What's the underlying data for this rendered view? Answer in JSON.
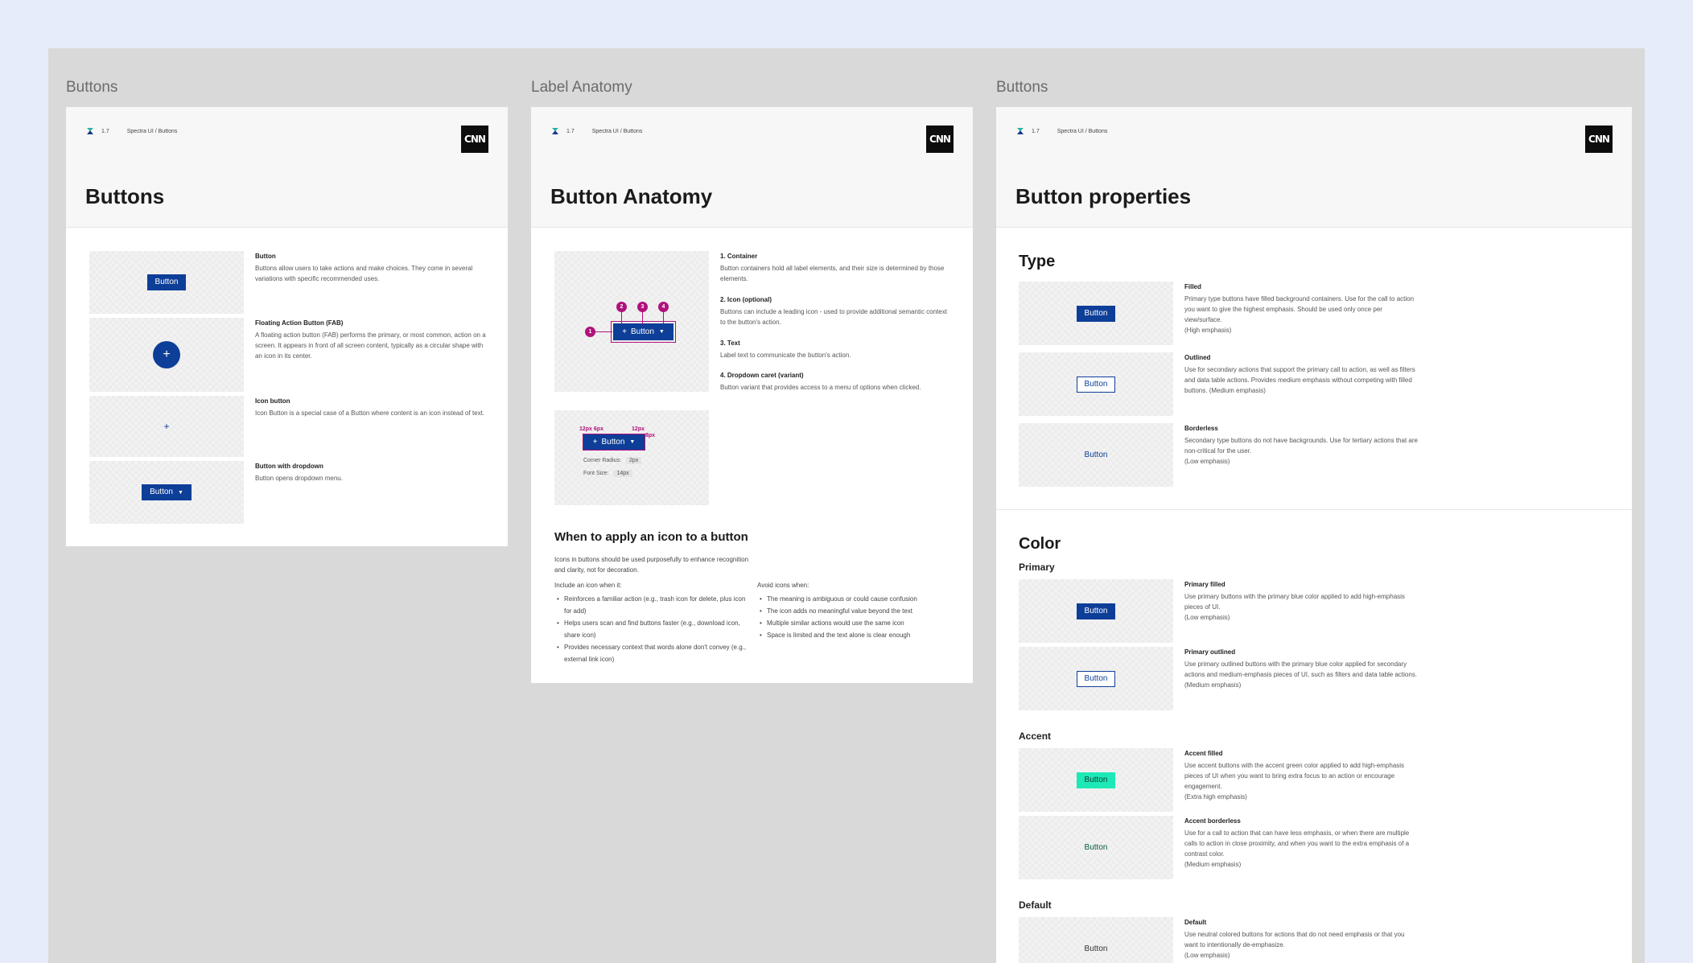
{
  "frames": [
    {
      "frame_label": "Buttons",
      "breadcrumb": {
        "version": "1.7",
        "path": "Spectra UI / Buttons"
      },
      "brand": "CNN",
      "heading": "Buttons",
      "items": [
        {
          "button": "Button",
          "title": "Button",
          "body": "Buttons allow users to take actions and make choices. They come in several variations with specific recommended uses."
        },
        {
          "button": "+",
          "title": "Floating Action Button (FAB)",
          "body": "A floating action button (FAB) performs the primary, or most common, action on a screen. It appears in front of all screen content, typically as a circular shape with an icon in its center."
        },
        {
          "button": "+",
          "title": "Icon button",
          "body": "Icon Button is a special case of a Button where content is an icon instead of text."
        },
        {
          "button": "Button",
          "title": "Button with dropdown",
          "body": "Button opens dropdown menu."
        }
      ]
    },
    {
      "frame_label": "Label Anatomy",
      "breadcrumb": {
        "version": "1.7",
        "path": "Spectra UI / Buttons"
      },
      "brand": "CNN",
      "heading": "Button Anatomy",
      "anatomy_button": "Button",
      "anatomy_pins": [
        "1",
        "2",
        "3",
        "4"
      ],
      "parts": [
        {
          "title": "1. Container",
          "body": "Button containers hold all label elements, and their size is determined by those elements."
        },
        {
          "title": "2. Icon (optional)",
          "body": "Buttons can include a leading icon - used to provide additional semantic context to the button's action."
        },
        {
          "title": "3. Text",
          "body": "Label text to communicate the button's action."
        },
        {
          "title": "4. Dropdown caret (variant)",
          "body": "Button variant that provides access to a menu of options when clicked."
        }
      ],
      "specs": {
        "button": "Button",
        "pad_left": "12px 6px",
        "pad_right": "12px",
        "pad_side": "8px",
        "corner_label": "Corner Radius:",
        "corner_value": "2px",
        "font_label": "Font Size:",
        "font_value": "14px"
      },
      "icon_section": {
        "title": "When to apply an icon to a button",
        "intro": "Icons in buttons should be used purposefully to enhance recognition and clarity, not for decoration.",
        "include_title": "Include an icon when it:",
        "include": [
          "Reinforces a familiar action (e.g., trash icon for delete, plus icon for add)",
          "Helps users scan and find buttons faster (e.g., download icon, share icon)",
          "Provides necessary context that words alone don't convey (e.g., external link icon)"
        ],
        "avoid_title": "Avoid icons when:",
        "avoid": [
          "The meaning is ambiguous or could cause confusion",
          "The icon adds no meaningful value beyond the text",
          "Multiple similar actions would use the same icon",
          "Space is limited and the text alone is clear enough"
        ]
      }
    },
    {
      "frame_label": "Buttons",
      "breadcrumb": {
        "version": "1.7",
        "path": "Spectra UI / Buttons"
      },
      "brand": "CNN",
      "heading": "Button properties",
      "type_title": "Type",
      "type_items": [
        {
          "button": "Button",
          "title": "Filled",
          "body": "Primary type buttons have filled background containers. Use for the call to action you want to give the highest emphasis. Should be used only once per view/surface.\n(High emphasis)"
        },
        {
          "button": "Button",
          "title": "Outlined",
          "body": "Use for secondary actions that support the primary call to action, as well as filters and data table actions. Provides medium emphasis without competing with filled buttons. (Medium emphasis)"
        },
        {
          "button": "Button",
          "title": "Borderless",
          "body": "Secondary type buttons do not have backgrounds. Use for tertiary actions that are non-critical for the user.\n(Low emphasis)"
        }
      ],
      "color_title": "Color",
      "primary_title": "Primary",
      "primary_items": [
        {
          "button": "Button",
          "title": "Primary filled",
          "body": "Use primary buttons with the primary blue color applied to add high-emphasis pieces of UI.\n(Low emphasis)"
        },
        {
          "button": "Button",
          "title": "Primary outlined",
          "body": "Use primary outlined buttons with the primary blue color applied for secondary actions and medium-emphasis pieces of UI, such as filters and data table actions. (Medium emphasis)"
        }
      ],
      "accent_title": "Accent",
      "accent_items": [
        {
          "button": "Button",
          "title": "Accent filled",
          "body": "Use accent buttons with the accent green color applied to add high-emphasis pieces of UI when you want to bring extra focus to an action or encourage engagement.\n(Extra high emphasis)"
        },
        {
          "button": "Button",
          "title": "Accent borderless",
          "body": "Use for a call to action that can have less emphasis, or when there are multiple calls to action in close proximity, and when you want to the extra emphasis of a contrast color.\n(Medium emphasis)"
        }
      ],
      "default_title": "Default",
      "default_items": [
        {
          "button": "Button",
          "title": "Default",
          "body": "Use neutral colored buttons for actions that do not need emphasis or that you want to intentionally de-emphasize.\n(Low emphasis)"
        }
      ]
    }
  ],
  "colors": {
    "primary": "#0d3e98",
    "accent": "#1de9b6",
    "annotation": "#b0117b"
  }
}
